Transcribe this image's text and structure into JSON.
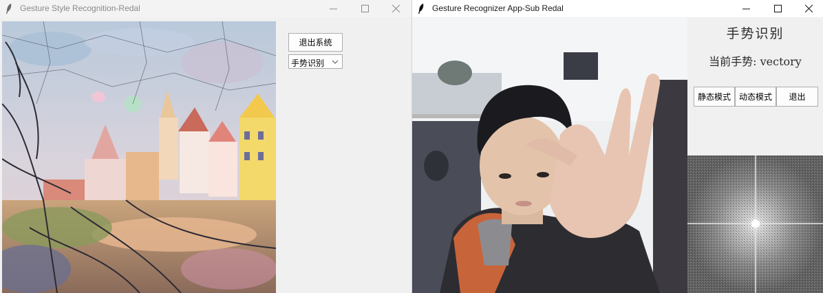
{
  "windows": [
    {
      "title": "Gesture Style Recognition-Redal",
      "exit_button": "退出系统",
      "mode_select": {
        "value": "手势识别"
      },
      "canvas": {
        "content": "stylized-street-painting"
      }
    },
    {
      "title": "Gesture Recognizer App-Sub Redal",
      "panel_title": "手势识别",
      "current_gesture_label": "当前手势: vectory",
      "buttons": {
        "static_mode": "静态模式",
        "dynamic_mode": "动态模式",
        "exit": "退出"
      },
      "camera_feed": {
        "content": "webcam-person-making-gesture"
      },
      "spectrum": {
        "content": "fourier-spectrum"
      }
    }
  ],
  "icons": {
    "app": "feather-icon",
    "minimize": "minimize-icon",
    "maximize": "maximize-icon",
    "close": "close-icon",
    "dropdown": "chevron-down-icon"
  },
  "colors": {
    "window_bg": "#f0f0f0",
    "button_border": "#adadad",
    "active_title_bg": "#ffffff"
  }
}
